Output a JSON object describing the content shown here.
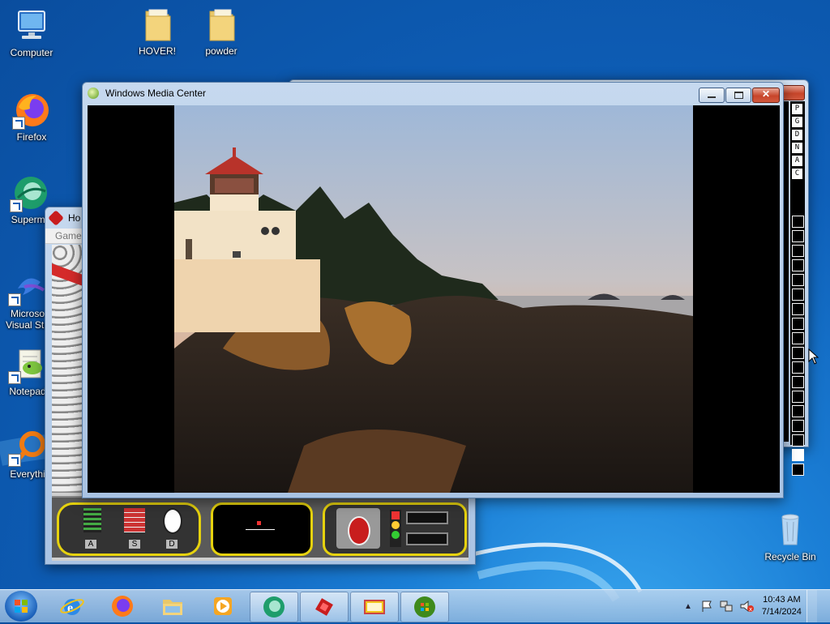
{
  "desktop": {
    "icons": [
      {
        "label": "Computer"
      },
      {
        "label": "HOVER!"
      },
      {
        "label": "powder"
      },
      {
        "label": "Firefox"
      },
      {
        "label": "Supermi"
      },
      {
        "label": "Microso"
      },
      {
        "label": "Visual Stu"
      },
      {
        "label": "Notepad"
      },
      {
        "label": "Everythi"
      },
      {
        "label": "Recycle Bin"
      }
    ]
  },
  "hover_window": {
    "title": "Ho",
    "menu": "Game",
    "panel_keys": [
      "A",
      "S",
      "D"
    ]
  },
  "powder_window": {
    "toolbar_letters": [
      "P",
      "G",
      "D",
      "N",
      "A",
      "C"
    ]
  },
  "media_center": {
    "title": "Windows Media Center",
    "photo_subject": "lighthouse-photo"
  },
  "taskbar": {
    "time": "10:43 AM",
    "date": "7/14/2024"
  },
  "colors": {
    "desktop_blue": "#0e5fb8",
    "accent_green": "#1e9d6b"
  }
}
